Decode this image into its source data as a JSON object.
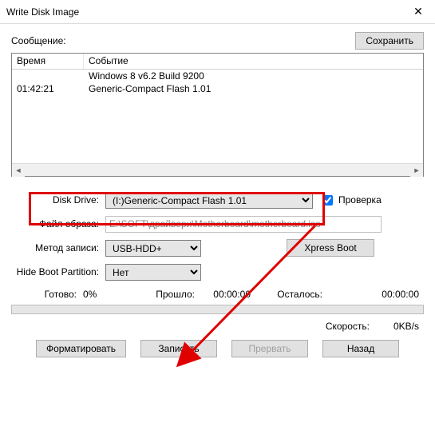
{
  "window": {
    "title": "Write Disk Image"
  },
  "message": {
    "label": "Сообщение:",
    "save_btn": "Сохранить"
  },
  "log": {
    "col_time": "Время",
    "col_event": "Событие",
    "rows": [
      {
        "time": "",
        "event": "Windows 8 v6.2 Build 9200"
      },
      {
        "time": "01:42:21",
        "event": "Generic-Compact Flash   1.01"
      }
    ]
  },
  "form": {
    "drive_label": "Disk Drive:",
    "drive_value": "(I:)Generic-Compact Flash   1.01",
    "check_label": "Проверка",
    "file_label": "Файл образа:",
    "file_value": "E:\\SOFT\\драйвери\\Motherboard\\motherboard.iso",
    "method_label": "Метод записи:",
    "method_value": "USB-HDD+",
    "xpress_btn": "Xpress Boot",
    "hide_label": "Hide Boot Partition:",
    "hide_value": "Нет"
  },
  "progress": {
    "ready_label": "Готово:",
    "ready_value": "0%",
    "elapsed_label": "Прошло:",
    "elapsed_value": "00:00:00",
    "remain_label": "Осталось:",
    "remain_value": "00:00:00",
    "speed_label": "Скорость:",
    "speed_value": "0KB/s"
  },
  "buttons": {
    "format": "Форматировать",
    "write": "Записать",
    "abort": "Прервать",
    "back": "Назад"
  }
}
